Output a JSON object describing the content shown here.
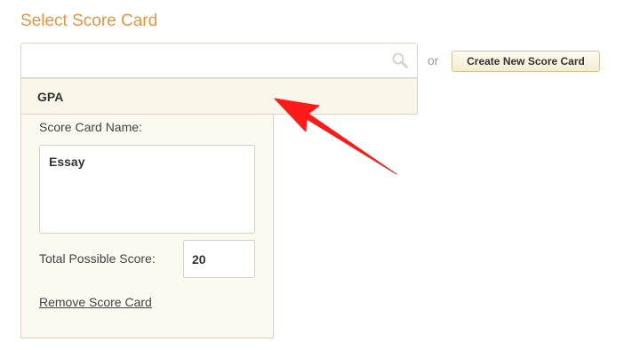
{
  "heading": "Select Score Card",
  "search": {
    "value": "",
    "placeholder": "",
    "icon": "search-icon"
  },
  "or_text": "or",
  "create_button_label": "Create New Score Card",
  "dropdown": {
    "options": [
      "GPA"
    ]
  },
  "card": {
    "name_label": "Score Card Name:",
    "name_value": "Essay",
    "total_label": "Total Possible Score:",
    "total_value": "20",
    "remove_label": "Remove Score Card"
  },
  "colors": {
    "heading": "#f0923a",
    "panel_bg": "#fcf9f0",
    "dropdown_bg": "#faf6ea",
    "annotation_arrow": "#ff0000"
  }
}
